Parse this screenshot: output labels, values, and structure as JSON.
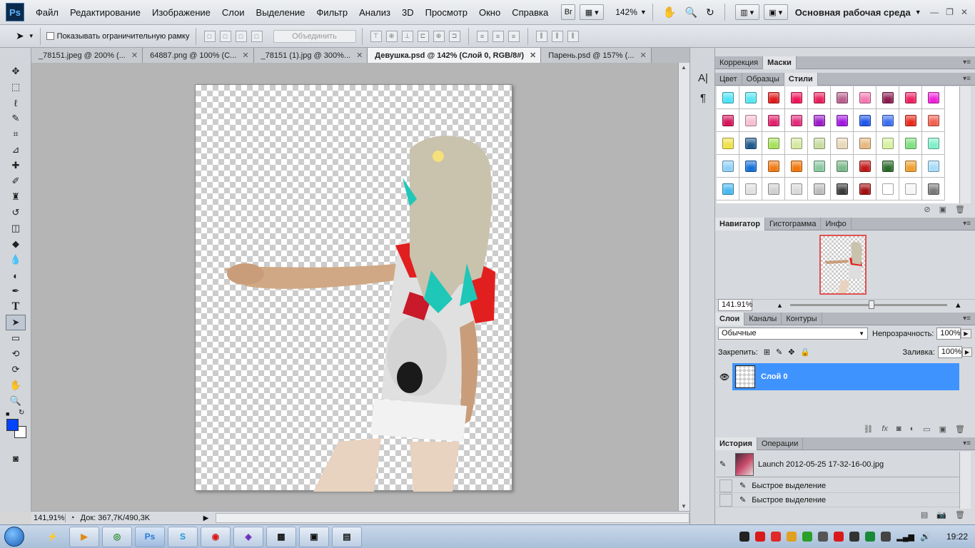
{
  "menu": {
    "logo": "Ps",
    "items": [
      "Файл",
      "Редактирование",
      "Изображение",
      "Слои",
      "Выделение",
      "Фильтр",
      "Анализ",
      "3D",
      "Просмотр",
      "Окно",
      "Справка"
    ],
    "bridge_label": "Br",
    "zoom": "142%",
    "workspace": "Основная рабочая среда"
  },
  "options": {
    "show_bounds_label": "Показывать ограничительную рамку",
    "combine_label": "Объединить"
  },
  "doc_tabs": [
    {
      "label": "_78151.jpeg @ 200% (...",
      "active": false
    },
    {
      "label": "64887.png @ 100% (С...",
      "active": false
    },
    {
      "label": "_78151 (1).jpg @ 300%...",
      "active": false
    },
    {
      "label": "Девушка.psd @ 142% (Слой 0, RGB/8#)",
      "active": true
    },
    {
      "label": "Парень.psd @ 157% (...",
      "active": false
    }
  ],
  "status": {
    "zoom": "141,91%",
    "doc_info": "Док: 367,7K/490,3K"
  },
  "panels": {
    "adjust_tabs": [
      "Коррекция",
      "Маски"
    ],
    "style_tabs": [
      "Цвет",
      "Образцы",
      "Стили"
    ],
    "nav_tabs": [
      "Навигатор",
      "Гистограмма",
      "Инфо"
    ],
    "nav_zoom": "141.91%",
    "layer_tabs": [
      "Слои",
      "Каналы",
      "Контуры"
    ],
    "blend_mode": "Обычные",
    "opacity_label": "Непрозрачность:",
    "opacity_value": "100%",
    "lock_label": "Закрепить:",
    "fill_label": "Заливка:",
    "fill_value": "100%",
    "layer_name": "Слой 0",
    "history_tabs": [
      "История",
      "Операции"
    ],
    "history_snapshot": "Launch 2012-05-25 17-32-16-00.jpg",
    "history_items": [
      "Быстрое выделение",
      "Быстрое выделение"
    ]
  },
  "style_colors": [
    "#4de3f5",
    "#58e6f2",
    "#e01b1b",
    "#f0145a",
    "#e8205e",
    "#b8608e",
    "#f47ab0",
    "#8b1c4e",
    "#ee2262",
    "#ee22d8",
    "#d6145a",
    "#f7bfcf",
    "#e0206a",
    "#e02a7a",
    "#9b1cc8",
    "#a218e0",
    "#1e55e8",
    "#3c6ff0",
    "#e82a1c",
    "#f06050",
    "#f0e24a",
    "#1e5a8c",
    "#a6e05a",
    "#d6e8a0",
    "#c8dca0",
    "#e8d8b8",
    "#e8b880",
    "#d8f0a0",
    "#7ee080",
    "#7ef0c8",
    "#8ed0f8",
    "#1470d8",
    "#f07a14",
    "#f0780a",
    "#8ac8a0",
    "#7ab88a",
    "#c01818",
    "#2a6a2a",
    "#f0a030",
    "#a6dcf8",
    "#4ab8f0",
    "#e0e0e0",
    "#d0d0d0",
    "#dadada",
    "#bdbdbd",
    "#3a3a3a",
    "#a01010",
    "#ffffff",
    "#f6f6f6",
    "#7a7a7a"
  ],
  "taskbar": {
    "apps": [
      "▶",
      "◎",
      "Ps",
      "S",
      "◉",
      "◈",
      "▦",
      "▣",
      "▤"
    ],
    "time": "19:22"
  }
}
